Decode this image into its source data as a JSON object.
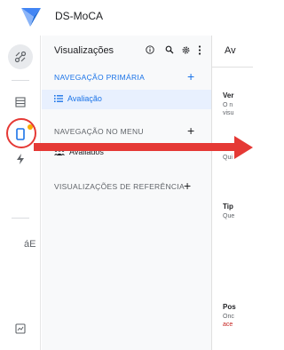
{
  "app": {
    "title": "DS-MoCA",
    "brand_color": "#1a73e8"
  },
  "rail": {
    "items": [
      {
        "name": "rail-item-connections",
        "icon": "connections-icon"
      },
      {
        "name": "rail-item-data",
        "icon": "table-icon"
      },
      {
        "name": "rail-item-views",
        "icon": "mobile-icon",
        "highlighted": true
      },
      {
        "name": "rail-item-actions",
        "icon": "lightning-icon"
      },
      {
        "name": "rail-item-settings",
        "icon": "settings-icon"
      }
    ],
    "stray_text": "áE"
  },
  "panel": {
    "title": "Visualizações",
    "sections": [
      {
        "label": "NAVEGAÇÃO PRIMÁRIA",
        "color": "#1a73e8"
      },
      {
        "label": "NAVEGAÇÃO NO MENU",
        "color": "#5f6368"
      },
      {
        "label": "VISUALIZAÇÕES DE REFERÊNCIA",
        "color": "#5f6368"
      }
    ],
    "items": [
      {
        "label": "Avaliação",
        "selected": true,
        "icon": "list-icon"
      },
      {
        "label": "Avaliados",
        "selected": false,
        "icon": "people-icon"
      }
    ]
  },
  "content": {
    "title": "Av",
    "blocks": [
      {
        "heading": "Ver",
        "lines": [
          "O n",
          "visu"
        ]
      },
      {
        "heading": "",
        "lines": [
          "Qui"
        ]
      },
      {
        "heading": "Tip",
        "lines": [
          "Que"
        ]
      },
      {
        "heading": "Pos",
        "lines": [
          "Onc",
          "ace"
        ]
      }
    ]
  },
  "annotation": {
    "color": "#e53935"
  }
}
